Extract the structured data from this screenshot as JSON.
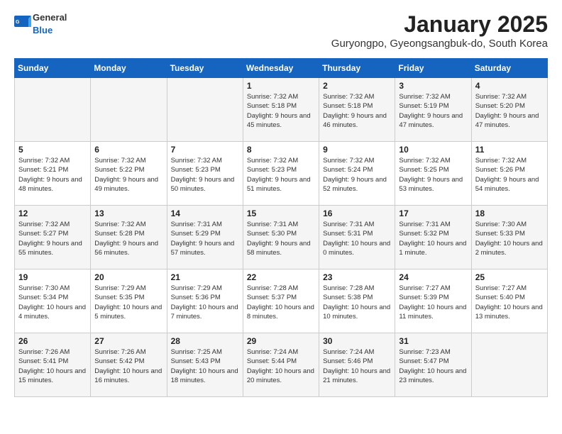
{
  "header": {
    "logo_general": "General",
    "logo_blue": "Blue",
    "month_title": "January 2025",
    "location": "Guryongpo, Gyeongsangbuk-do, South Korea"
  },
  "weekdays": [
    "Sunday",
    "Monday",
    "Tuesday",
    "Wednesday",
    "Thursday",
    "Friday",
    "Saturday"
  ],
  "weeks": [
    [
      {
        "day": "",
        "info": ""
      },
      {
        "day": "",
        "info": ""
      },
      {
        "day": "",
        "info": ""
      },
      {
        "day": "1",
        "info": "Sunrise: 7:32 AM\nSunset: 5:18 PM\nDaylight: 9 hours\nand 45 minutes."
      },
      {
        "day": "2",
        "info": "Sunrise: 7:32 AM\nSunset: 5:18 PM\nDaylight: 9 hours\nand 46 minutes."
      },
      {
        "day": "3",
        "info": "Sunrise: 7:32 AM\nSunset: 5:19 PM\nDaylight: 9 hours\nand 47 minutes."
      },
      {
        "day": "4",
        "info": "Sunrise: 7:32 AM\nSunset: 5:20 PM\nDaylight: 9 hours\nand 47 minutes."
      }
    ],
    [
      {
        "day": "5",
        "info": "Sunrise: 7:32 AM\nSunset: 5:21 PM\nDaylight: 9 hours\nand 48 minutes."
      },
      {
        "day": "6",
        "info": "Sunrise: 7:32 AM\nSunset: 5:22 PM\nDaylight: 9 hours\nand 49 minutes."
      },
      {
        "day": "7",
        "info": "Sunrise: 7:32 AM\nSunset: 5:23 PM\nDaylight: 9 hours\nand 50 minutes."
      },
      {
        "day": "8",
        "info": "Sunrise: 7:32 AM\nSunset: 5:23 PM\nDaylight: 9 hours\nand 51 minutes."
      },
      {
        "day": "9",
        "info": "Sunrise: 7:32 AM\nSunset: 5:24 PM\nDaylight: 9 hours\nand 52 minutes."
      },
      {
        "day": "10",
        "info": "Sunrise: 7:32 AM\nSunset: 5:25 PM\nDaylight: 9 hours\nand 53 minutes."
      },
      {
        "day": "11",
        "info": "Sunrise: 7:32 AM\nSunset: 5:26 PM\nDaylight: 9 hours\nand 54 minutes."
      }
    ],
    [
      {
        "day": "12",
        "info": "Sunrise: 7:32 AM\nSunset: 5:27 PM\nDaylight: 9 hours\nand 55 minutes."
      },
      {
        "day": "13",
        "info": "Sunrise: 7:32 AM\nSunset: 5:28 PM\nDaylight: 9 hours\nand 56 minutes."
      },
      {
        "day": "14",
        "info": "Sunrise: 7:31 AM\nSunset: 5:29 PM\nDaylight: 9 hours\nand 57 minutes."
      },
      {
        "day": "15",
        "info": "Sunrise: 7:31 AM\nSunset: 5:30 PM\nDaylight: 9 hours\nand 58 minutes."
      },
      {
        "day": "16",
        "info": "Sunrise: 7:31 AM\nSunset: 5:31 PM\nDaylight: 10 hours\nand 0 minutes."
      },
      {
        "day": "17",
        "info": "Sunrise: 7:31 AM\nSunset: 5:32 PM\nDaylight: 10 hours\nand 1 minute."
      },
      {
        "day": "18",
        "info": "Sunrise: 7:30 AM\nSunset: 5:33 PM\nDaylight: 10 hours\nand 2 minutes."
      }
    ],
    [
      {
        "day": "19",
        "info": "Sunrise: 7:30 AM\nSunset: 5:34 PM\nDaylight: 10 hours\nand 4 minutes."
      },
      {
        "day": "20",
        "info": "Sunrise: 7:29 AM\nSunset: 5:35 PM\nDaylight: 10 hours\nand 5 minutes."
      },
      {
        "day": "21",
        "info": "Sunrise: 7:29 AM\nSunset: 5:36 PM\nDaylight: 10 hours\nand 7 minutes."
      },
      {
        "day": "22",
        "info": "Sunrise: 7:28 AM\nSunset: 5:37 PM\nDaylight: 10 hours\nand 8 minutes."
      },
      {
        "day": "23",
        "info": "Sunrise: 7:28 AM\nSunset: 5:38 PM\nDaylight: 10 hours\nand 10 minutes."
      },
      {
        "day": "24",
        "info": "Sunrise: 7:27 AM\nSunset: 5:39 PM\nDaylight: 10 hours\nand 11 minutes."
      },
      {
        "day": "25",
        "info": "Sunrise: 7:27 AM\nSunset: 5:40 PM\nDaylight: 10 hours\nand 13 minutes."
      }
    ],
    [
      {
        "day": "26",
        "info": "Sunrise: 7:26 AM\nSunset: 5:41 PM\nDaylight: 10 hours\nand 15 minutes."
      },
      {
        "day": "27",
        "info": "Sunrise: 7:26 AM\nSunset: 5:42 PM\nDaylight: 10 hours\nand 16 minutes."
      },
      {
        "day": "28",
        "info": "Sunrise: 7:25 AM\nSunset: 5:43 PM\nDaylight: 10 hours\nand 18 minutes."
      },
      {
        "day": "29",
        "info": "Sunrise: 7:24 AM\nSunset: 5:44 PM\nDaylight: 10 hours\nand 20 minutes."
      },
      {
        "day": "30",
        "info": "Sunrise: 7:24 AM\nSunset: 5:46 PM\nDaylight: 10 hours\nand 21 minutes."
      },
      {
        "day": "31",
        "info": "Sunrise: 7:23 AM\nSunset: 5:47 PM\nDaylight: 10 hours\nand 23 minutes."
      },
      {
        "day": "",
        "info": ""
      }
    ]
  ]
}
